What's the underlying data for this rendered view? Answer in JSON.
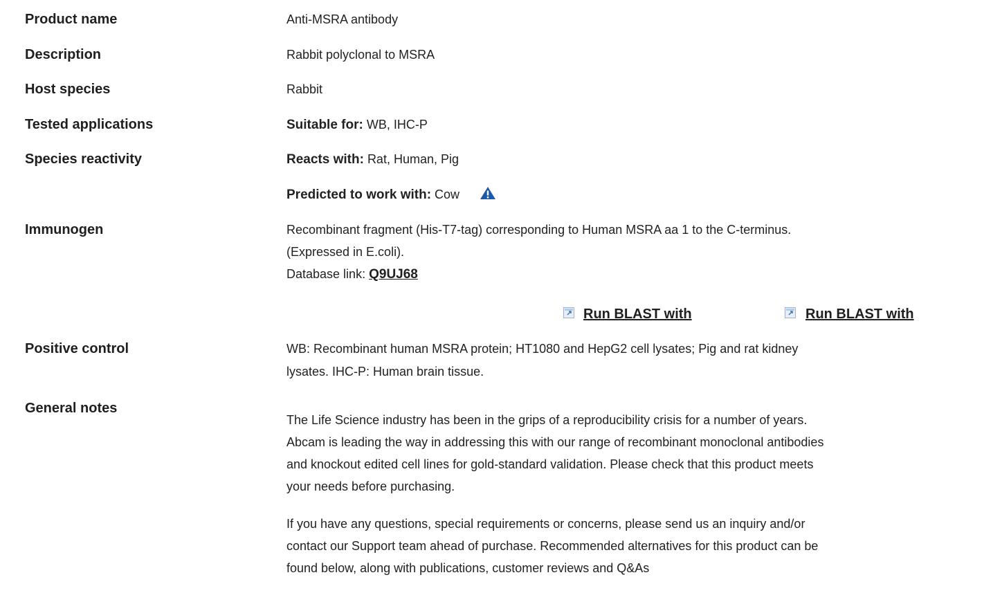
{
  "product_name": {
    "label": "Product name",
    "value": "Anti-MSRA antibody"
  },
  "description": {
    "label": "Description",
    "value": "Rabbit polyclonal to MSRA"
  },
  "host_species": {
    "label": "Host species",
    "value": "Rabbit"
  },
  "tested_applications": {
    "label": "Tested applications",
    "prefix": "Suitable for:",
    "value": "WB, IHC-P"
  },
  "species_reactivity": {
    "label": "Species reactivity",
    "reacts_prefix": "Reacts with:",
    "reacts_value": "Rat, Human, Pig",
    "predicted_prefix": "Predicted to work with:",
    "predicted_value": "Cow",
    "warning_icon": "warning-triangle-icon",
    "warning_color": "#1a5aa8"
  },
  "immunogen": {
    "label": "Immunogen",
    "line1": "Recombinant fragment (His-T7-tag) corresponding to Human MSRA aa 1 to the C-terminus.",
    "line2": "(Expressed in E.coli).",
    "db_prefix": "Database link:",
    "db_link": "Q9UJ68",
    "blast_links": [
      "Run BLAST with",
      "Run BLAST with"
    ],
    "external_icon": "external-link-icon"
  },
  "positive_control": {
    "label": "Positive control",
    "line1": "WB: Recombinant human MSRA protein; HT1080 and HepG2 cell lysates; Pig and rat kidney",
    "line2": "lysates. IHC-P: Human brain tissue."
  },
  "general_notes": {
    "label": "General notes",
    "paragraph1_lines": [
      "The Life Science industry has been in the grips of a reproducibility crisis for a number of years.",
      "Abcam is leading the way in addressing this with our range of recombinant monoclonal antibodies",
      "and knockout edited cell lines for gold-standard validation. Please check that this product meets",
      "your needs before purchasing."
    ],
    "paragraph2_lines": [
      "If you have any questions, special requirements or concerns, please send us an inquiry and/or",
      "contact our Support team ahead of purchase. Recommended alternatives for this product can be",
      "found below, along with publications, customer reviews and Q&As"
    ]
  }
}
